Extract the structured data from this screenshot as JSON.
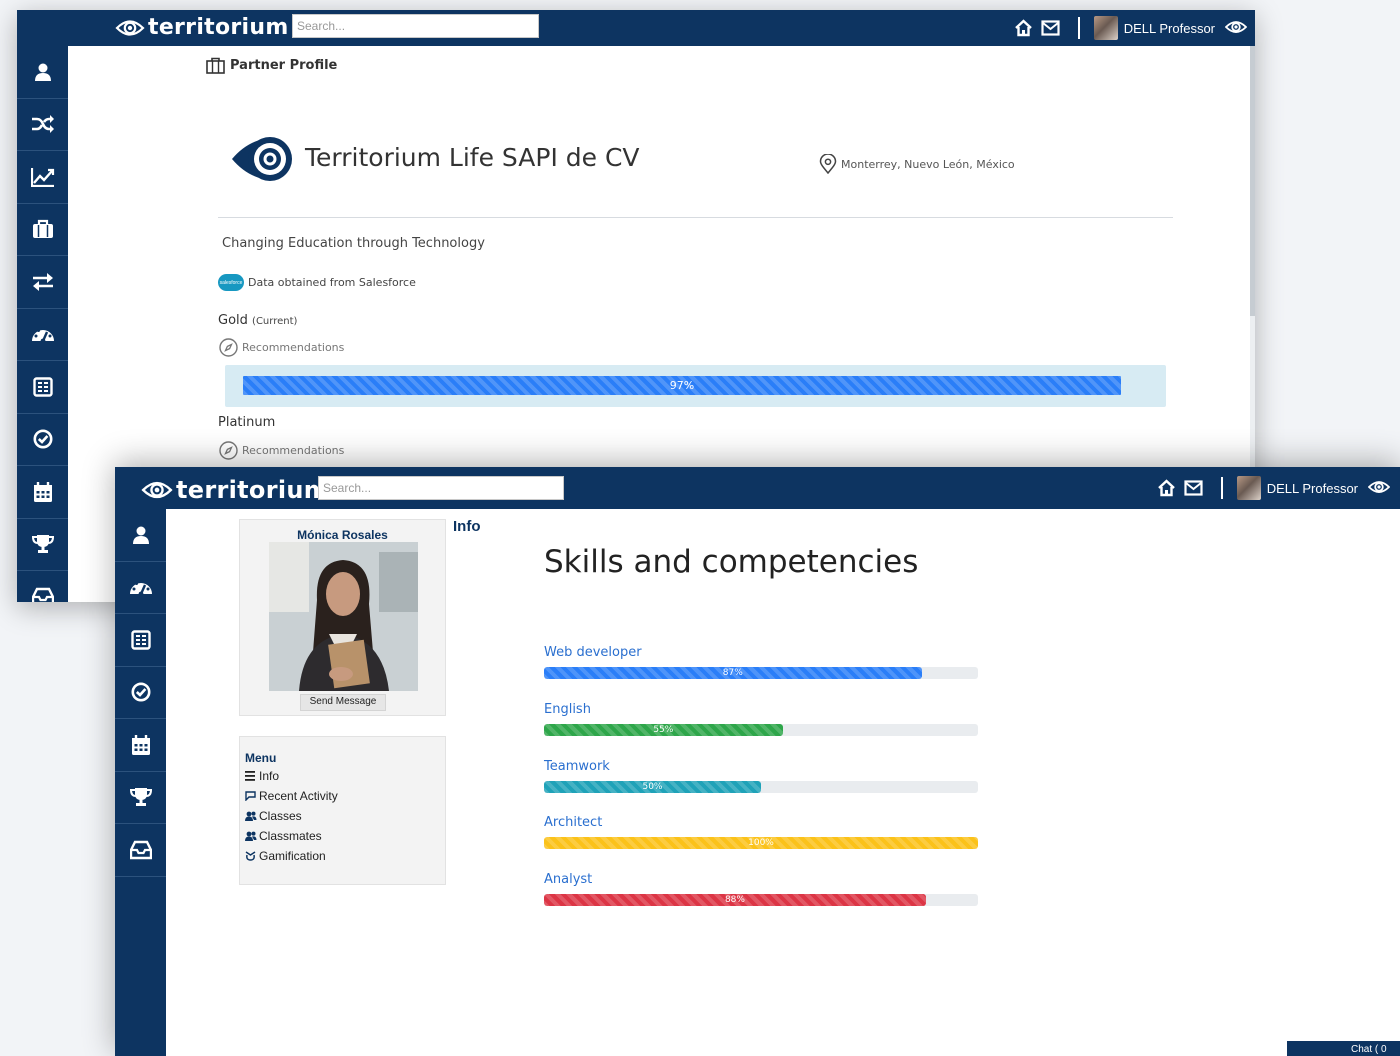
{
  "back_window": {
    "brand": "territorium",
    "search": {
      "placeholder": "Search..."
    },
    "user": {
      "name": "DELL Professor"
    },
    "breadcrumb": "Partner Profile",
    "company": {
      "name": "Territorium Life SAPI de CV",
      "location": "Monterrey, Nuevo León, México",
      "tagline": "Changing Education through Technology",
      "source_text": "Data obtained from Salesforce",
      "source_logo_text": "salesforce"
    },
    "tiers": [
      {
        "name": "Gold",
        "note": "(Current)",
        "recommendations": "Recommendations",
        "progress": 97,
        "progress_label": "97%"
      },
      {
        "name": "Platinum",
        "recommendations": "Recommendations"
      }
    ],
    "sidebar_icons": [
      "user-icon",
      "shuffle-icon",
      "chart-icon",
      "briefcase-icon",
      "transfer-icon",
      "dashboard-icon",
      "gradebook-icon",
      "check-circle-icon",
      "calendar-icon",
      "trophy-icon",
      "inbox-icon"
    ]
  },
  "front_window": {
    "brand": "territorium",
    "search": {
      "placeholder": "Search..."
    },
    "user": {
      "name": "DELL Professor"
    },
    "profile": {
      "name": "Mónica Rosales",
      "send_message": "Send Message"
    },
    "menu": {
      "title": "Menu",
      "items": [
        {
          "label": "Info",
          "icon": "list-icon"
        },
        {
          "label": "Recent Activity",
          "icon": "comment-icon"
        },
        {
          "label": "Classes",
          "icon": "users-icon"
        },
        {
          "label": "Classmates",
          "icon": "users-icon"
        },
        {
          "label": "Gamification",
          "icon": "gamepad-icon"
        }
      ]
    },
    "info_heading": "Info",
    "skills_title": "Skills and competencies",
    "skills": [
      {
        "name": "Web developer",
        "percent": 87,
        "label": "87%",
        "color": "#2a7ef8"
      },
      {
        "name": "English",
        "percent": 55,
        "label": "55%",
        "color": "#2ea64a"
      },
      {
        "name": "Teamwork",
        "percent": 50,
        "label": "50%",
        "color": "#1fa2b8"
      },
      {
        "name": "Architect",
        "percent": 100,
        "label": "100%",
        "color": "#fbc21a"
      },
      {
        "name": "Analyst",
        "percent": 88,
        "label": "88%",
        "color": "#dc3545"
      }
    ],
    "chat_label": "Chat ( 0",
    "sidebar_icons": [
      "user-icon",
      "dashboard-icon",
      "gradebook-icon",
      "check-circle-icon",
      "calendar-icon",
      "trophy-icon",
      "inbox-icon"
    ]
  },
  "colors": {
    "navy": "#0d3461",
    "link_blue": "#2a6fcf",
    "gold_panel": "#d7ebf3"
  }
}
